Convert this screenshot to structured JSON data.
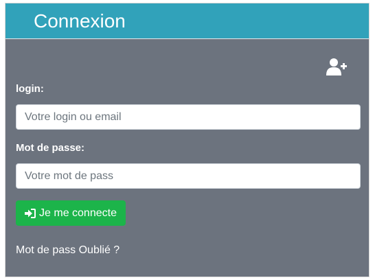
{
  "header": {
    "title": "Connexion"
  },
  "toolbar": {
    "add_user_icon": "user-plus-icon"
  },
  "form": {
    "login_label": "login:",
    "login_placeholder": "Votre login ou email",
    "login_value": "",
    "password_label": "Mot de passe:",
    "password_placeholder": "Votre mot de pass",
    "password_value": "",
    "submit_label": "Je me connecte",
    "submit_icon": "sign-in-icon",
    "forgot_label": "Mot de pass Oublié ?"
  },
  "colors": {
    "header_bg": "#31a2ba",
    "panel_bg": "#6c737e",
    "button_bg": "#1cb44a",
    "text": "#ffffff"
  }
}
